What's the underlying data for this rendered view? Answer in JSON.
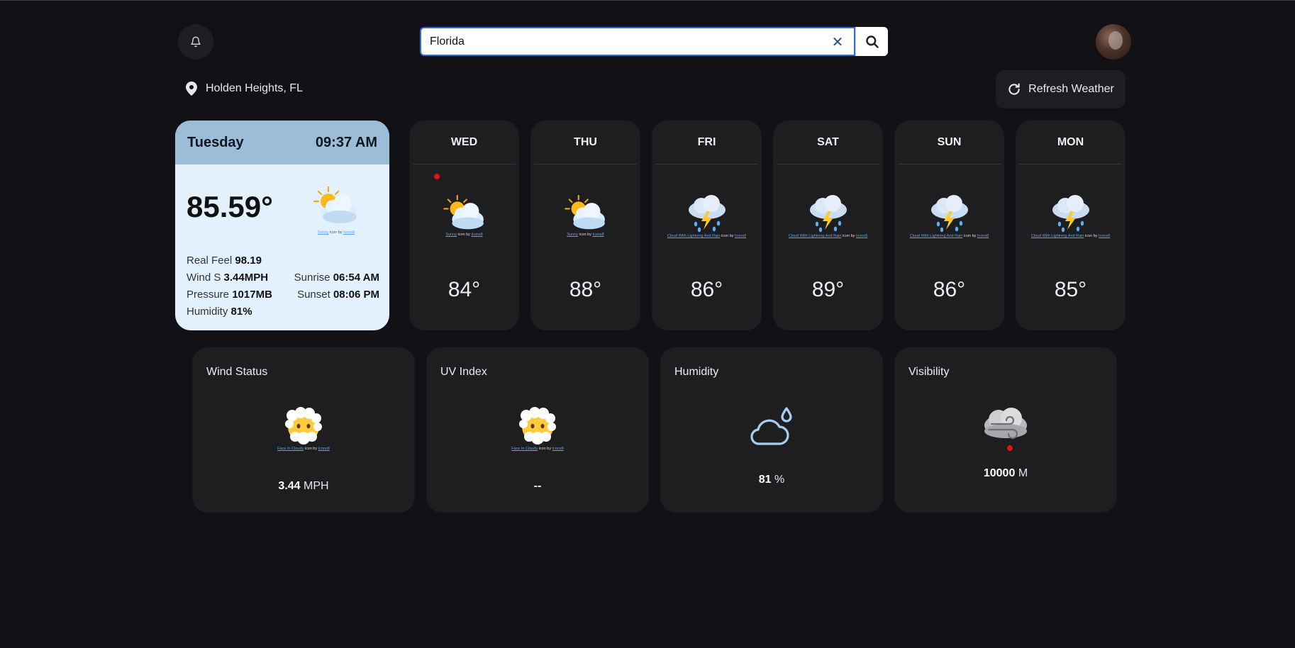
{
  "search": {
    "value": "Florida",
    "placeholder": ""
  },
  "location": "Holden Heights, FL",
  "refresh_label": "Refresh Weather",
  "today": {
    "day": "Tuesday",
    "time": "09:37 AM",
    "temp": "85.59°",
    "icon": "sun-behind-cloud-icon",
    "credit_link": "Sunny",
    "real_feel_label": "Real Feel",
    "real_feel": "98.19",
    "wind_label": "Wind S",
    "wind": "3.44MPH",
    "sunrise_label": "Sunrise",
    "sunrise": "06:54 AM",
    "pressure_label": "Pressure",
    "pressure": "1017MB",
    "sunset_label": "Sunset",
    "sunset": "08:06 PM",
    "humidity_label": "Humidity",
    "humidity": "81%"
  },
  "credit_common": {
    "icon_by": "icon by",
    "author": "Icons8"
  },
  "forecast": [
    {
      "day": "WED",
      "temp": "84°",
      "icon": "sun-behind-cloud-icon",
      "credit_link": "Sunny"
    },
    {
      "day": "THU",
      "temp": "88°",
      "icon": "sun-behind-cloud-icon",
      "credit_link": "Sunny"
    },
    {
      "day": "FRI",
      "temp": "86°",
      "icon": "cloud-lightning-rain-icon",
      "credit_link": "Cloud With Lightning And Rain"
    },
    {
      "day": "SAT",
      "temp": "89°",
      "icon": "cloud-lightning-rain-icon",
      "credit_link": "Cloud With Lightning And Rain"
    },
    {
      "day": "SUN",
      "temp": "86°",
      "icon": "cloud-lightning-rain-icon",
      "credit_link": "Cloud With Lightning And Rain"
    },
    {
      "day": "MON",
      "temp": "85°",
      "icon": "cloud-lightning-rain-icon",
      "credit_link": "Cloud With Lightning And Rain"
    }
  ],
  "highlights": {
    "wind": {
      "title": "Wind Status",
      "value": "3.44",
      "unit": "MPH",
      "credit_link": "Face In Clouds"
    },
    "uv": {
      "title": "UV Index",
      "value": "--",
      "credit_link": "Face In Clouds"
    },
    "humidity": {
      "title": "Humidity",
      "value": "81",
      "unit": "%"
    },
    "visibility": {
      "title": "Visibility",
      "value": "10000",
      "unit": "M"
    }
  },
  "colors": {
    "background": "#111116",
    "card": "#1e1e21",
    "today_card": "#e3f1fe",
    "today_header": "#9bbdd8",
    "accent": "#2f6fd1"
  }
}
